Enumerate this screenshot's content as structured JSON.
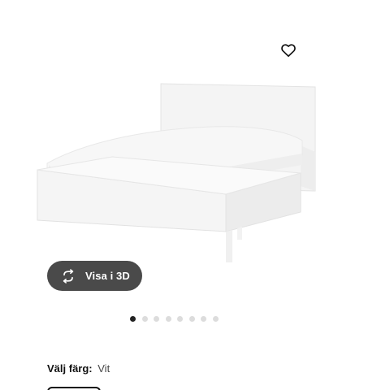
{
  "favorite": {
    "icon": "heart-outline-icon"
  },
  "product": {
    "image": "white-bed-frame-with-mattress"
  },
  "view3d": {
    "label": "Visa i 3D",
    "icon": "rotate-arrows-icon"
  },
  "carousel": {
    "total": 8,
    "active_index": 1
  },
  "color": {
    "label": "Välj färg:",
    "value": "Vit"
  },
  "colors": {
    "accent": "#111111",
    "button_bg": "#4a4a4a",
    "dot_active": "#222222",
    "dot_inactive": "#dcdcdc"
  }
}
